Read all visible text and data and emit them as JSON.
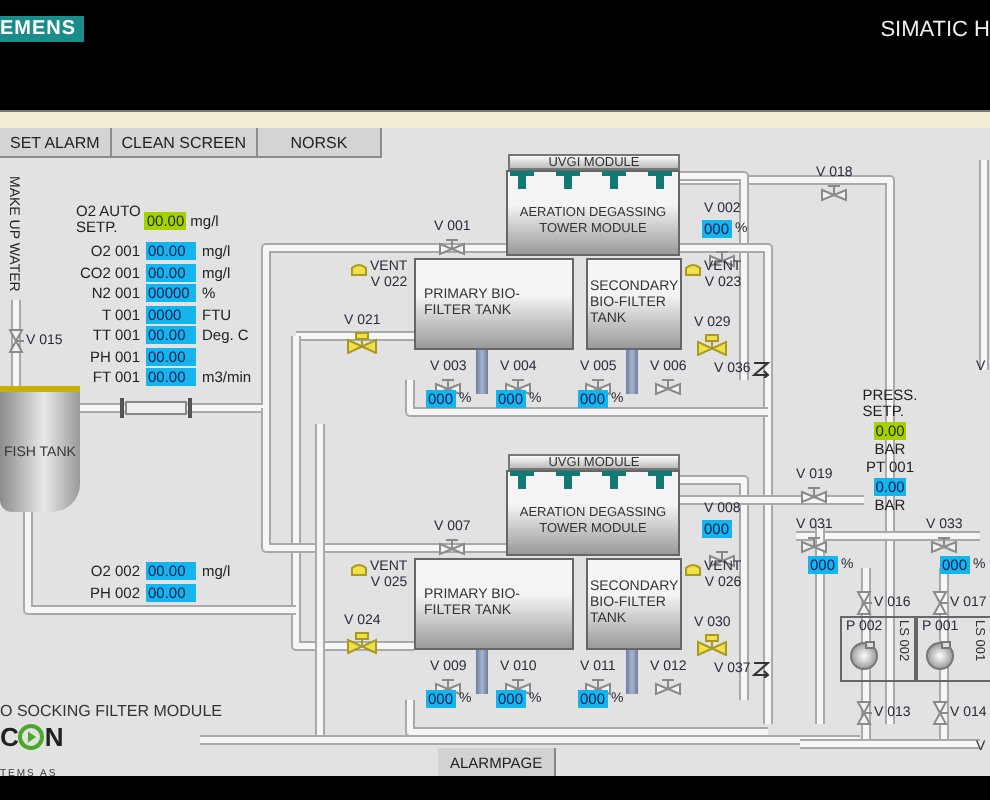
{
  "header": {
    "logo": "EMENS",
    "product": "SIMATIC H"
  },
  "toolbar": [
    "SET ALARM",
    "CLEAN SCREEN",
    "NORSK"
  ],
  "side_label": "MAKE UP WATER",
  "setpoint": {
    "label": [
      "O2 AUTO",
      "SETP."
    ],
    "value": "00.00",
    "unit": "mg/l"
  },
  "measurements": [
    {
      "label": "O2 001",
      "value": "00.00",
      "unit": "mg/l"
    },
    {
      "label": "CO2 001",
      "value": "00.00",
      "unit": "mg/l"
    },
    {
      "label": "N2 001",
      "value": "00000",
      "unit": "%"
    },
    {
      "label": "T  001",
      "value": "0000",
      "unit": "FTU"
    },
    {
      "label": "TT 001",
      "value": "00.00",
      "unit": "Deg. C"
    },
    {
      "label": "PH 001",
      "value": "00.00"
    },
    {
      "label": "FT 001",
      "value": "00.00",
      "unit": "m3/min"
    }
  ],
  "fish_tank": {
    "label": "FISH TANK"
  },
  "lower_measurements": [
    {
      "label": "O2 002",
      "value": "00.00",
      "unit": "mg/l"
    },
    {
      "label": "PH 002",
      "value": "00.00"
    }
  ],
  "modules": [
    {
      "uvgi": "UVGI MODULE",
      "tower": "AERATION DEGASSING TOWER MODULE",
      "primary": "PRIMARY BIO-FILTER TANK",
      "secondary": "SECONDARY BIO-FILTER TANK",
      "tower_valve": {
        "label": "V 002",
        "value": "000",
        "unit": "%"
      },
      "valves": [
        {
          "label": "V 001",
          "kind": "manual"
        },
        {
          "label": "V 022",
          "kind": "vent",
          "tag": "VENT"
        },
        {
          "label": "V 021",
          "kind": "control"
        },
        {
          "label": "V 023",
          "kind": "vent",
          "tag": "VENT"
        },
        {
          "label": "V 029",
          "kind": "control"
        },
        {
          "label": "V 003",
          "kind": "manual"
        },
        {
          "label": "V 004",
          "kind": "manual"
        },
        {
          "label": "V 005",
          "kind": "manual"
        },
        {
          "label": "V 006",
          "kind": "manual"
        },
        {
          "label": "V 036",
          "kind": "check"
        }
      ],
      "readouts": [
        {
          "value": "000",
          "unit": "%"
        },
        {
          "value": "000",
          "unit": "%"
        },
        {
          "value": "000",
          "unit": "%"
        }
      ]
    },
    {
      "uvgi": "UVGI MODULE",
      "tower": "AERATION DEGASSING TOWER MODULE",
      "primary": "PRIMARY BIO-FILTER TANK",
      "secondary": "SECONDARY BIO-FILTER TANK",
      "tower_valve": {
        "label": "V 008",
        "value": "000"
      },
      "valves": [
        {
          "label": "V 007",
          "kind": "manual"
        },
        {
          "label": "V 025",
          "kind": "vent",
          "tag": "VENT"
        },
        {
          "label": "V 024",
          "kind": "control"
        },
        {
          "label": "V 026",
          "kind": "vent",
          "tag": "VENT"
        },
        {
          "label": "V 030",
          "kind": "control"
        },
        {
          "label": "V 009",
          "kind": "manual"
        },
        {
          "label": "V 010",
          "kind": "manual"
        },
        {
          "label": "V 011",
          "kind": "manual"
        },
        {
          "label": "V 012",
          "kind": "manual"
        },
        {
          "label": "V 037",
          "kind": "check"
        }
      ],
      "readouts": [
        {
          "value": "000",
          "unit": "%"
        },
        {
          "value": "000",
          "unit": "%"
        },
        {
          "value": "000",
          "unit": "%"
        }
      ]
    }
  ],
  "valves": [
    {
      "label": "V 015",
      "kind": "vertical"
    },
    {
      "label": "V 018",
      "kind": "manual"
    },
    {
      "label": "V 019",
      "kind": "manual"
    },
    {
      "label": "V 031",
      "kind": "manual"
    },
    {
      "label": "V 033",
      "kind": "manual"
    },
    {
      "label": "V 016",
      "kind": "vertical"
    },
    {
      "label": "V 017",
      "kind": "vertical"
    },
    {
      "label": "V 013",
      "kind": "vertical"
    },
    {
      "label": "V 014",
      "kind": "vertical"
    }
  ],
  "cut_labels": [
    "V",
    "V"
  ],
  "right_readouts": [
    {
      "value": "000",
      "unit": "%"
    },
    {
      "value": "000",
      "unit": "%"
    }
  ],
  "pressure": {
    "setpoint_label": [
      "PRESS.",
      "SETP."
    ],
    "setpoint_value": "0.00",
    "setpoint_unit": "BAR",
    "sensor_label": "PT 001",
    "sensor_value": "0.00",
    "sensor_unit": "BAR"
  },
  "pumps": [
    {
      "label": "P 002",
      "switch": "LS 002"
    },
    {
      "label": "P 001",
      "switch": "LS 001"
    }
  ],
  "module_label": "O SOCKING FILTER MODULE",
  "company_logo": {
    "left": "C",
    "right": "N",
    "subtitle": "TEMS AS"
  },
  "alarm_button": "ALARMPAGE"
}
